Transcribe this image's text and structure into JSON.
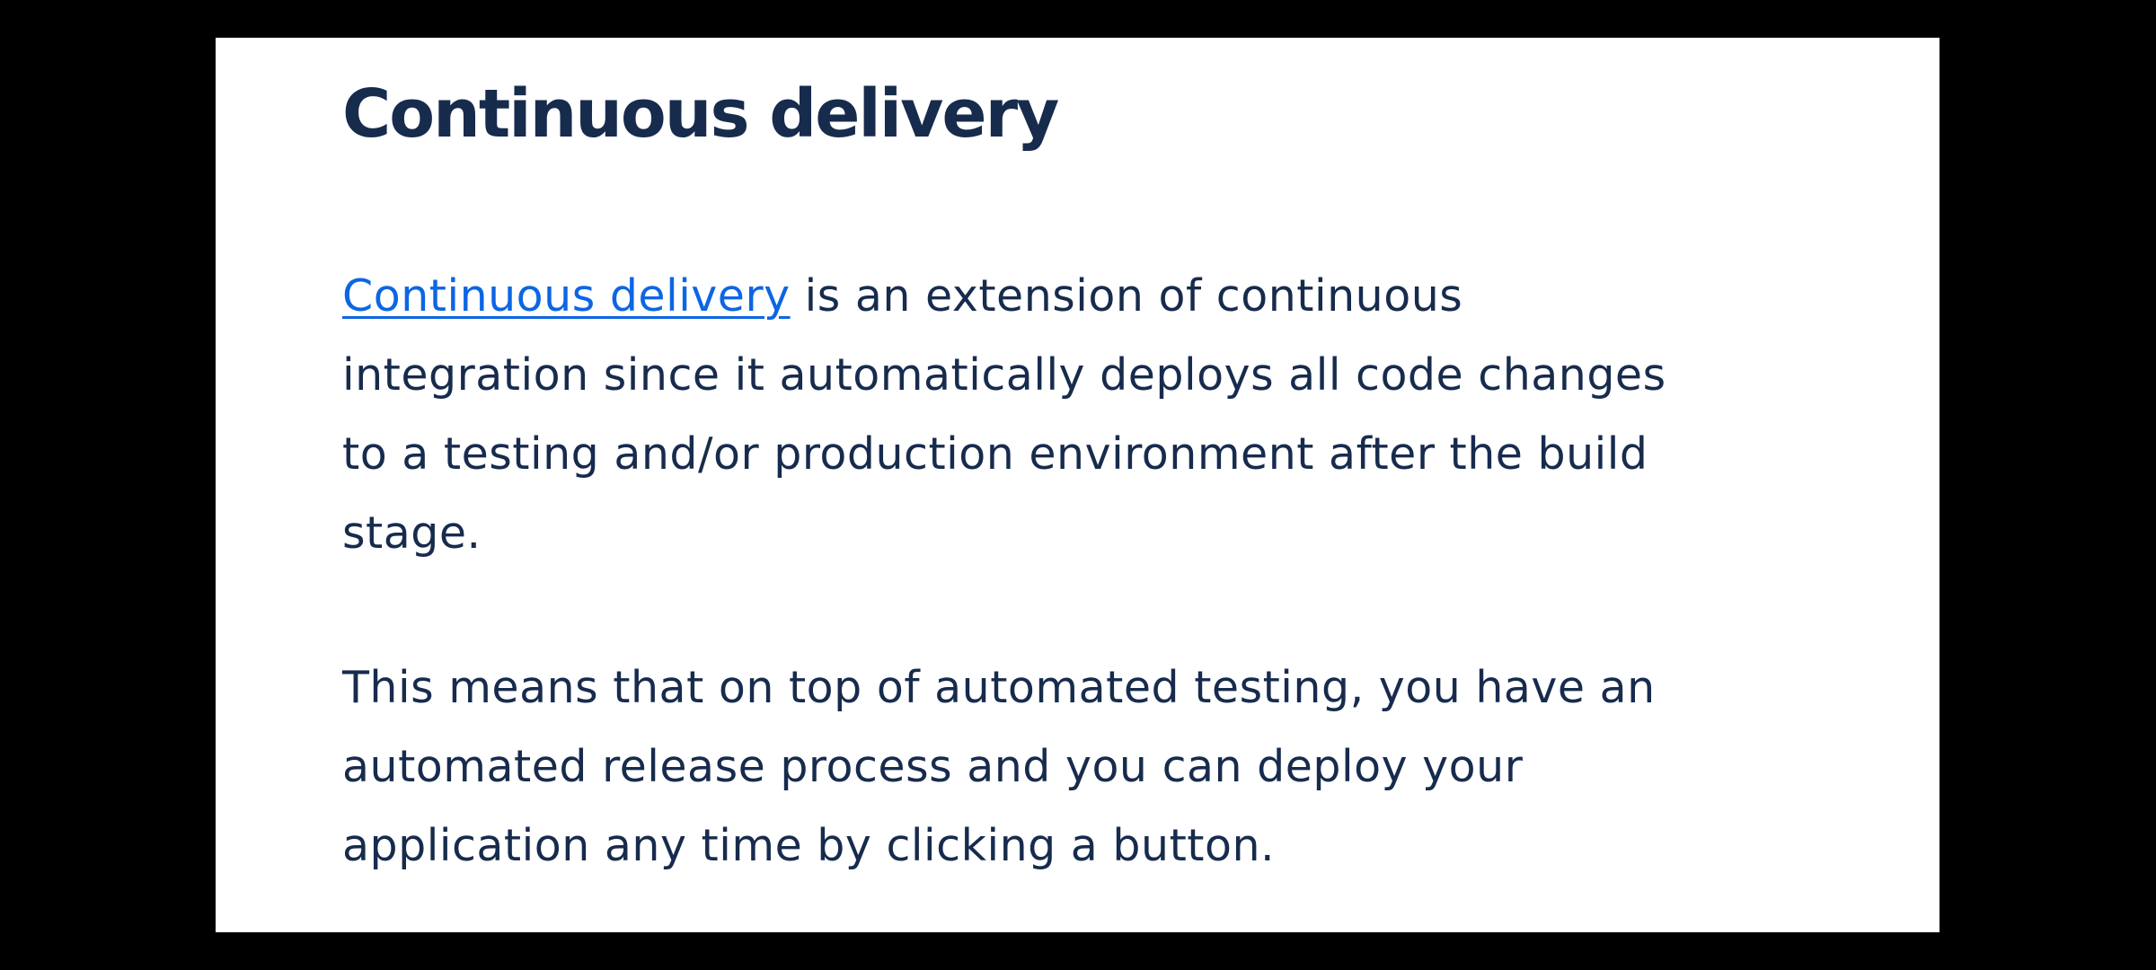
{
  "article": {
    "heading": "Continuous delivery",
    "paragraph1": {
      "link_text": "Continuous delivery",
      "line1_rest": " is an extension of continuous",
      "line2": "integration since it automatically deploys all code changes",
      "line3": "to a testing and/or production environment after the build",
      "line4": "stage."
    },
    "paragraph2": {
      "line1": "This means that on top of automated testing, you have an",
      "line2": "automated release process and you can deploy your",
      "line3": "application any time by clicking a button."
    }
  },
  "colors": {
    "text": "#172b4d",
    "link": "#0c66e4",
    "card": "#ffffff",
    "background": "#000000"
  }
}
